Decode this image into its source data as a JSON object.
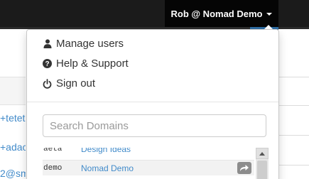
{
  "navbar": {
    "account_label": "Rob @ Nomad Demo"
  },
  "background": {
    "links": [
      "+tetet",
      "+adac",
      "2@sm"
    ]
  },
  "menu": {
    "items": [
      {
        "label": "Manage users",
        "icon": "user-icon"
      },
      {
        "label": "Help & Support",
        "icon": "question-circle-icon"
      },
      {
        "label": "Sign out",
        "icon": "power-icon"
      }
    ],
    "search": {
      "placeholder": "Search Domains",
      "value": ""
    },
    "domains": [
      {
        "id": "aeta",
        "name": "Design Ideas"
      },
      {
        "id": "demo",
        "name": "Nomad Demo"
      }
    ]
  },
  "colors": {
    "navbar": "#1b1b1b",
    "link": "#428bca",
    "text": "#333333"
  }
}
